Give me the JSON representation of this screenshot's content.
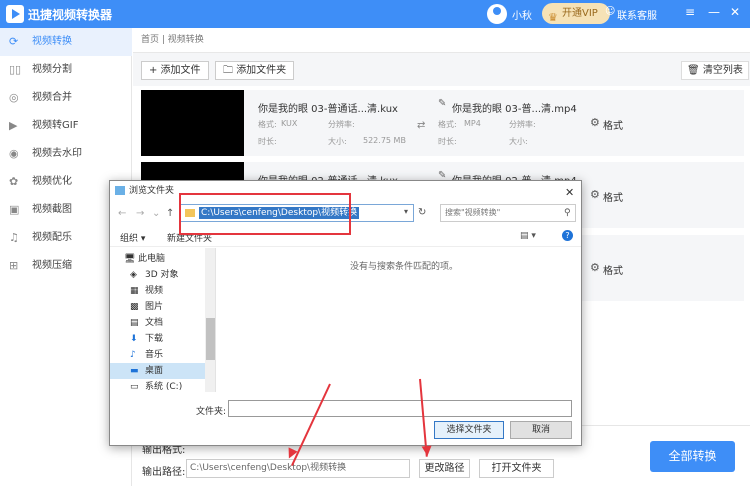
{
  "app": {
    "title": "迅捷视频转换器",
    "user": "小秋",
    "vip": "开通VIP",
    "service": "联系客服"
  },
  "sidebar": {
    "items": [
      {
        "label": "视频转换",
        "icon": "video-convert-icon"
      },
      {
        "label": "视频分割",
        "icon": "split-icon"
      },
      {
        "label": "视频合并",
        "icon": "merge-icon"
      },
      {
        "label": "视频转GIF",
        "icon": "gif-icon"
      },
      {
        "label": "视频去水印",
        "icon": "watermark-icon"
      },
      {
        "label": "视频优化",
        "icon": "optimize-icon"
      },
      {
        "label": "视频截图",
        "icon": "screenshot-icon"
      },
      {
        "label": "视频配乐",
        "icon": "music-icon"
      },
      {
        "label": "视频压缩",
        "icon": "compress-icon"
      }
    ]
  },
  "breadcrumb": "首页 | 视频转换",
  "toolbar": {
    "add_file": "+ 添加文件",
    "add_folder": "添加文件夹",
    "clear": "清空列表"
  },
  "files": [
    {
      "src": "你是我的眼 03-普通话...清.kux",
      "dst": "你是我的眼 03-普...清.mp4",
      "fmt_label": "格式:",
      "fmt": "KUX",
      "res_label": "分辨率:",
      "dur_label": "时长:",
      "size_label": "大小:",
      "size": "522.75 MB",
      "out_fmt": "MP4",
      "format_btn": "格式"
    },
    {
      "src": "你是我的眼 02-普通话...清.kux",
      "dst": "你是我的眼 02-普...清.mp4",
      "format_btn": "格式"
    },
    {
      "format_btn": "格式"
    }
  ],
  "bottom": {
    "out_label": "输出路径:",
    "out_path": "C:\\Users\\cenfeng\\Desktop\\视频转换",
    "change": "更改路径",
    "open": "打开文件夹",
    "convert_all": "全部转换",
    "hidden_label": "输出格式:"
  },
  "dialog": {
    "title": "浏览文件夹",
    "address": "C:\\Users\\cenfeng\\Desktop\\视频转换",
    "search_placeholder": "搜索\"视频转换\"",
    "organize": "组织 ▾",
    "new_folder": "新建文件夹",
    "empty": "没有与搜索条件匹配的项。",
    "tree": [
      {
        "label": "此电脑",
        "icon": "computer-icon"
      },
      {
        "label": "3D 对象",
        "icon": "cube-icon"
      },
      {
        "label": "视频",
        "icon": "video-icon"
      },
      {
        "label": "图片",
        "icon": "picture-icon"
      },
      {
        "label": "文档",
        "icon": "document-icon"
      },
      {
        "label": "下载",
        "icon": "download-icon"
      },
      {
        "label": "音乐",
        "icon": "music-note-icon"
      },
      {
        "label": "桌面",
        "icon": "desktop-icon"
      },
      {
        "label": "系统 (C:)",
        "icon": "drive-icon"
      }
    ],
    "filename_label": "文件夹:",
    "select": "选择文件夹",
    "cancel": "取消"
  }
}
